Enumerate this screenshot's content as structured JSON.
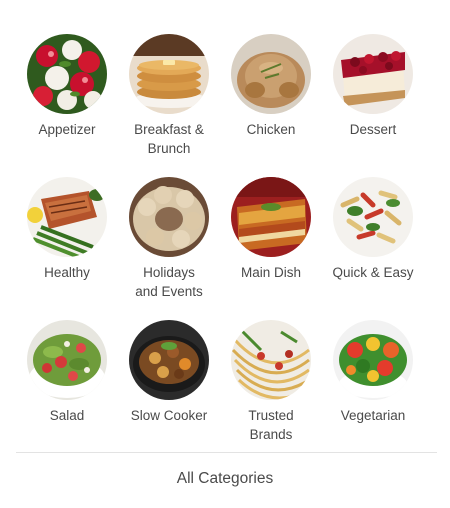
{
  "categories": [
    {
      "label": "Appetizer",
      "image": "caprese-appetizer-photo"
    },
    {
      "label": "Breakfast &\nBrunch",
      "image": "pancake-stack-photo"
    },
    {
      "label": "Chicken",
      "image": "roast-chicken-photo"
    },
    {
      "label": "Dessert",
      "image": "cherry-cheesecake-photo"
    },
    {
      "label": "Healthy",
      "image": "salmon-asparagus-photo"
    },
    {
      "label": "Holidays\nand Events",
      "image": "holiday-pastry-wreath-photo"
    },
    {
      "label": "Main Dish",
      "image": "lasagna-photo"
    },
    {
      "label": "Quick & Easy",
      "image": "pasta-salad-photo"
    },
    {
      "label": "Salad",
      "image": "strawberry-spinach-salad-photo"
    },
    {
      "label": "Slow Cooker",
      "image": "slow-cooker-stew-photo"
    },
    {
      "label": "Trusted\nBrands",
      "image": "spaghetti-photo"
    },
    {
      "label": "Vegetarian",
      "image": "vegetable-medley-photo"
    }
  ],
  "footer": {
    "all_categories_label": "All Categories"
  }
}
